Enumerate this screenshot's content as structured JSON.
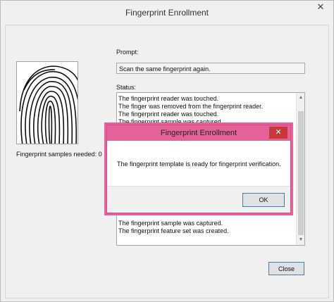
{
  "window": {
    "title": "Fingerprint Enrollment",
    "close_glyph": "✕"
  },
  "left": {
    "samples_label": "Fingerprint samples needed: 0"
  },
  "prompt": {
    "label": "Prompt:",
    "value": "Scan the same fingerprint again."
  },
  "status": {
    "label": "Status:",
    "lines_top": [
      "The fingerprint reader was touched.",
      "The finger was removed from the fingerprint reader.",
      "The fingerprint reader was touched.",
      "The fingerprint sample was captured."
    ],
    "lines_bottom": [
      "The fingerprint sample was captured.",
      "The fingerprint feature set was created."
    ]
  },
  "buttons": {
    "close_label": "Close"
  },
  "dialog": {
    "title": "Fingerprint Enrollment",
    "close_glyph": "✕",
    "message": "The fingerprint template is ready for fingerprint verification.",
    "ok_label": "OK"
  },
  "scroll_glyphs": {
    "up": "▲",
    "down": "▼"
  }
}
